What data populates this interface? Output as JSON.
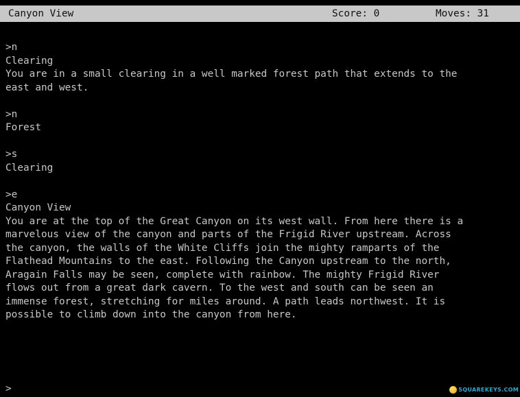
{
  "status_bar": {
    "location": "Canyon View",
    "score": "Score: 0",
    "moves": "Moves: 31"
  },
  "transcript": {
    "lines": [
      ">n",
      "Clearing",
      "You are in a small clearing in a well marked forest path that extends to the",
      "east and west.",
      "",
      ">n",
      "Forest",
      "",
      ">s",
      "Clearing",
      "",
      ">e",
      "Canyon View",
      "You are at the top of the Great Canyon on its west wall. From here there is a",
      "marvelous view of the canyon and parts of the Frigid River upstream. Across",
      "the canyon, the walls of the White Cliffs join the mighty ramparts of the",
      "Flathead Mountains to the east. Following the Canyon upstream to the north,",
      "Aragain Falls may be seen, complete with rainbow. The mighty Frigid River",
      "flows out from a great dark cavern. To the west and south can be seen an",
      "immense forest, stretching for miles around. A path leads northwest. It is",
      "possible to climb down into the canyon from here."
    ]
  },
  "input": {
    "prompt": ">",
    "value": ""
  },
  "watermark": {
    "text": "SQUAREKEYS.COM",
    "colors": {
      "text": "#2aa7c9",
      "accent": "#e0a800"
    },
    "icon": "coin-logo-icon"
  },
  "colors": {
    "background": "#000000",
    "text": "#c8c8c8",
    "status_bar_bg": "#c8c8c8",
    "status_bar_text": "#101010"
  }
}
